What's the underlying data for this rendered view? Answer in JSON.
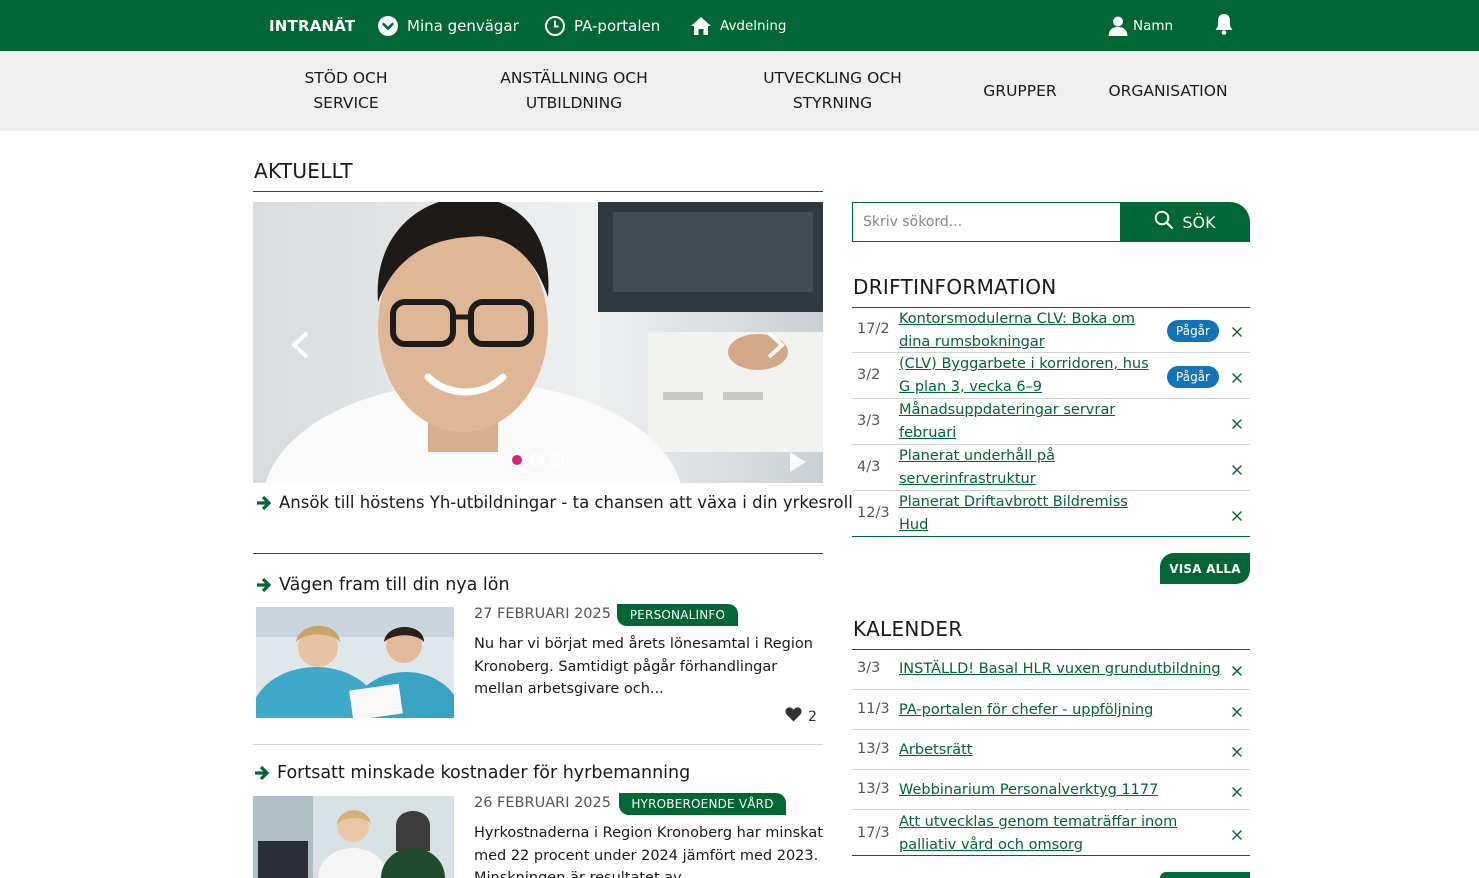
{
  "topbar": {
    "brand": "INTRANÄT",
    "shortcuts": "Mina genvägar",
    "pa_portal": "PA-portalen",
    "department": "Avdelning",
    "user": "Namn"
  },
  "mainnav": [
    {
      "label": "STÖD OCH\nSERVICE"
    },
    {
      "label": "ANSTÄLLNING OCH\nUTBILDNING"
    },
    {
      "label": "UTVECKLING OCH\nSTYRNING"
    },
    {
      "label": "GRUPPER"
    },
    {
      "label": "ORGANISATION"
    }
  ],
  "aktuellt": {
    "heading": "AKTUELLT",
    "carousel_caption": "Ansök till höstens Yh-utbildningar - ta chansen att växa i din yrkesroll",
    "news": [
      {
        "title": "Vägen fram till din nya lön",
        "date": "27 FEBRUARI 2025",
        "tag": "PERSONALINFO",
        "excerpt": "Nu har vi börjat med årets lönesamtal i Region Kronoberg. Samtidigt pågår förhandlingar mellan arbetsgivare och...",
        "likes": "2"
      },
      {
        "title": "Fortsatt minskade kostnader för hyrbemanning",
        "date": "26 FEBRUARI 2025",
        "tag": "HYROBEROENDE VÅRD",
        "excerpt": "Hyrkostnaderna i Region Kronoberg har minskat med 22 procent under 2024 jämfört med 2023. Minskningen är resultatet av"
      }
    ]
  },
  "search": {
    "placeholder": "Skriv sökord...",
    "button": "SÖK"
  },
  "drift": {
    "heading": "DRIFTINFORMATION",
    "items": [
      {
        "date": "17/2",
        "text": "Kontorsmodulerna CLV: Boka om dina rumsbokningar",
        "badge": "Pågår"
      },
      {
        "date": "3/2",
        "text": "(CLV) Byggarbete i korridoren, hus G plan 3, vecka 6–9",
        "badge": "Pågår"
      },
      {
        "date": "3/3",
        "text": "Månadsuppdateringar servrar februari"
      },
      {
        "date": "4/3",
        "text": "Planerat underhåll på serverinfrastruktur"
      },
      {
        "date": "12/3",
        "text": "Planerat Driftavbrott Bildremiss Hud"
      }
    ],
    "show_all": "VISA ALLA"
  },
  "kalender": {
    "heading": "KALENDER",
    "items": [
      {
        "date": "3/3",
        "text": "INSTÄLLD! Basal HLR vuxen grundutbildning"
      },
      {
        "date": "11/3",
        "text": "PA-portalen för chefer - uppföljning"
      },
      {
        "date": "13/3",
        "text": "Arbetsrätt"
      },
      {
        "date": "13/3",
        "text": "Webbinarium Personalverktyg 1177"
      },
      {
        "date": "17/3",
        "text": "Att utvecklas genom tematräffar inom palliativ vård och omsorg"
      }
    ]
  },
  "colors": {
    "brand_green": "#006633",
    "badge_blue": "#1273b8",
    "dot_active": "#d6247a"
  }
}
